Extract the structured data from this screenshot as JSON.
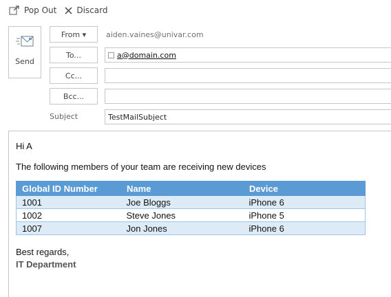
{
  "toolbar": {
    "popout_label": "Pop Out",
    "discard_label": "Discard",
    "popout_icon": "popout-icon",
    "discard_icon": "close-icon"
  },
  "compose": {
    "send_label": "Send",
    "send_icon": "envelope-send-icon",
    "from_label": "From ▾",
    "from_address": "aiden.vaines@univar.com",
    "to_label": "To...",
    "to_recipients": [
      "a@domain.com"
    ],
    "cc_label": "Cc...",
    "cc_value": "",
    "bcc_label": "Bcc...",
    "bcc_value": "",
    "subject_label": "Subject",
    "subject_value": "TestMailSubject"
  },
  "message": {
    "greeting": "Hi A",
    "intro": "The following members of your team are receiving new devices",
    "table": {
      "header_color": "#5b9bd5",
      "alt_row_color": "#ddebf7",
      "columns": [
        "Global ID Number",
        "Name",
        "Device"
      ],
      "rows": [
        [
          "1001",
          "Joe Bloggs",
          "iPhone 6"
        ],
        [
          "1002",
          "Steve Jones",
          "iPhone 5"
        ],
        [
          "1007",
          "Jon Jones",
          "iPhone 6"
        ]
      ]
    },
    "closing": "Best regards,",
    "signature": "IT Department"
  }
}
